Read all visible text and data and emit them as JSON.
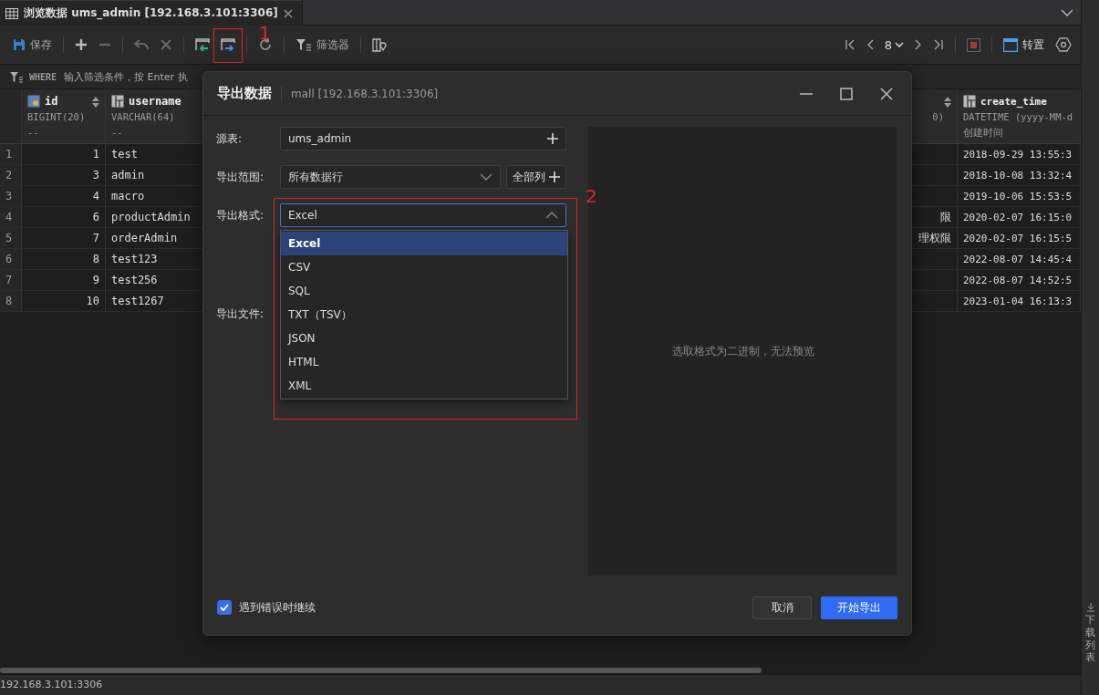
{
  "tab": {
    "title": "浏览数据 ums_admin [192.168.3.101:3306]",
    "selected": true
  },
  "toolbar": {
    "save_label": "保存",
    "filter_label": "筛选器",
    "page_size": "8",
    "transpose_label": "转置"
  },
  "filter_bar": {
    "keyword": "WHERE",
    "placeholder": "输入筛选条件，按 Enter 执"
  },
  "table": {
    "columns": [
      {
        "kind": "key",
        "name": "id",
        "type": "BIGINT(20)",
        "comment": "--"
      },
      {
        "kind": "field",
        "name": "username",
        "type": "VARCHAR(64)",
        "comment": "--"
      },
      {
        "kind": "partial",
        "type": "0)"
      },
      {
        "kind": "field",
        "name": "create_time",
        "type": "DATETIME (yyyy-MM-d",
        "comment": "创建时间"
      }
    ],
    "rows": [
      {
        "index": "1",
        "cells": [
          "1",
          "test",
          "",
          "2018-09-29 13:55:3"
        ]
      },
      {
        "index": "2",
        "cells": [
          "3",
          "admin",
          "",
          "2018-10-08 13:32:4"
        ]
      },
      {
        "index": "3",
        "cells": [
          "4",
          "macro",
          "",
          "2019-10-06 15:53:5"
        ]
      },
      {
        "index": "4",
        "cells": [
          "6",
          "productAdmin",
          "限",
          "2020-02-07 16:15:0"
        ]
      },
      {
        "index": "5",
        "cells": [
          "7",
          "orderAdmin",
          "理权限",
          "2020-02-07 16:15:5"
        ]
      },
      {
        "index": "6",
        "cells": [
          "8",
          "test123",
          "",
          "2022-08-07 14:45:4"
        ]
      },
      {
        "index": "7",
        "cells": [
          "9",
          "test256",
          "",
          "2022-08-07 14:52:5"
        ]
      },
      {
        "index": "8",
        "cells": [
          "10",
          "test1267",
          "",
          "2023-01-04 16:13:3"
        ]
      }
    ]
  },
  "side_panel": {
    "label": "下载列表"
  },
  "status_bar": {
    "connection": "192.168.3.101:3306"
  },
  "dialog": {
    "title": "导出数据",
    "connection": "mall [192.168.3.101:3306]",
    "fields": [
      {
        "kind": "input",
        "label": "源表:",
        "value": "ums_admin"
      },
      {
        "kind": "select",
        "label": "导出范围:",
        "value": "所有数据行",
        "button": "全部列"
      },
      {
        "kind": "select",
        "label": "导出格式:",
        "value": "Excel",
        "expanded": true,
        "options": [
          {
            "label": "Excel",
            "selected": true
          },
          {
            "label": "CSV",
            "selected": false
          },
          {
            "label": "SQL",
            "selected": false
          },
          {
            "label": "TXT（TSV）",
            "selected": false
          },
          {
            "label": "JSON",
            "selected": false
          },
          {
            "label": "HTML",
            "selected": false
          },
          {
            "label": "XML",
            "selected": false
          }
        ]
      },
      {
        "kind": "file",
        "label": "导出文件:"
      }
    ],
    "preview_message": "选取格式为二进制，无法预览",
    "continue_on_error": {
      "label": "遇到错误时继续",
      "checked": true
    },
    "buttons": [
      {
        "kind": "secondary",
        "label": "取消"
      },
      {
        "kind": "primary",
        "label": "开始导出"
      }
    ]
  },
  "annotations": [
    {
      "label": "1"
    },
    {
      "label": "2"
    }
  ]
}
